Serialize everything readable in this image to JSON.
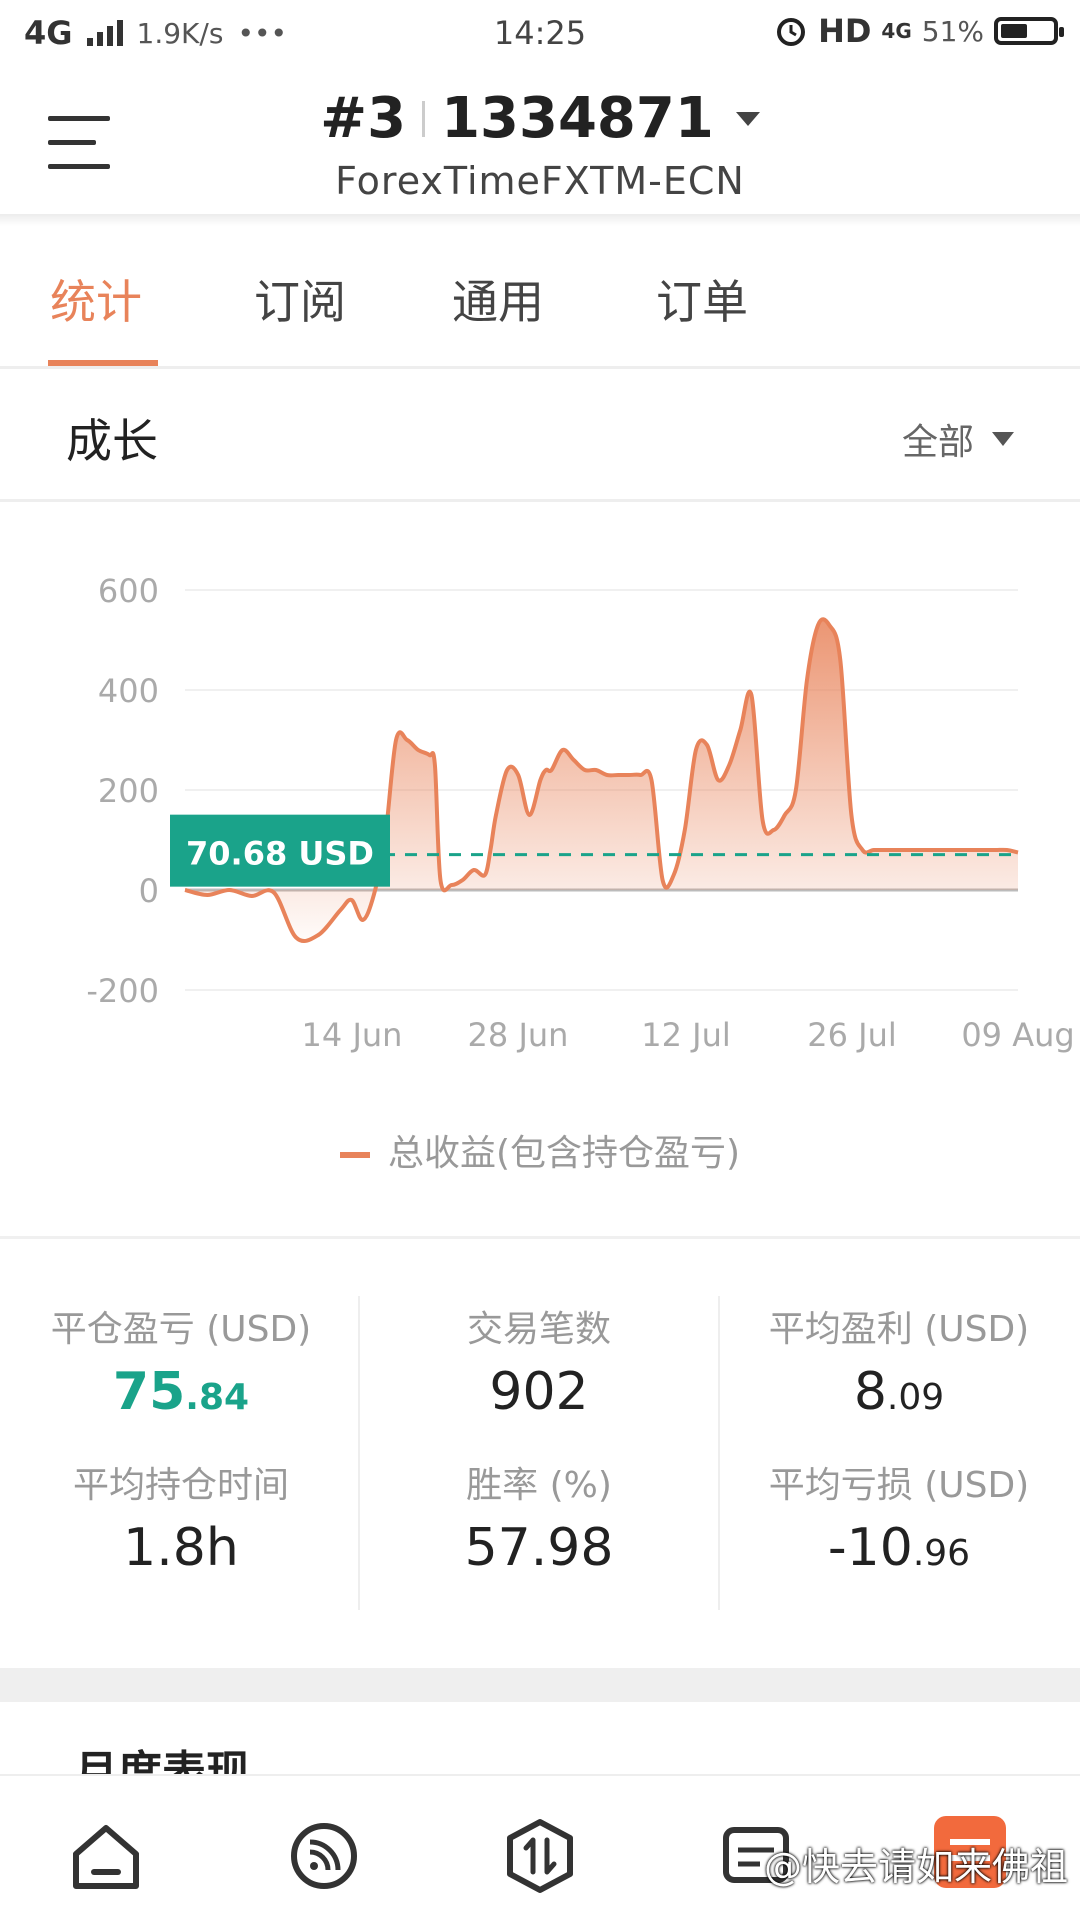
{
  "status_bar": {
    "network": "4G",
    "speed": "1.9K/s",
    "more": "•••",
    "time": "14:25",
    "hd": "HD",
    "net_right": "4G",
    "battery": "51%"
  },
  "header": {
    "account_index": "#3",
    "account_number": "1334871",
    "broker": "ForexTimeFXTM-ECN"
  },
  "tabs": [
    {
      "label": "统计",
      "active": true
    },
    {
      "label": "订阅",
      "active": false
    },
    {
      "label": "通用",
      "active": false
    },
    {
      "label": "订单",
      "active": false
    }
  ],
  "growth": {
    "title": "成长",
    "filter": "全部"
  },
  "chart_data": {
    "type": "area",
    "series": [
      {
        "name": "总收益(包含持仓盈亏)",
        "color": "#e8835a",
        "x": [
          0,
          2,
          4,
          6,
          8,
          10,
          12,
          14,
          15,
          16,
          17,
          18,
          19,
          20,
          21,
          22,
          22.5,
          23,
          24,
          25,
          26,
          27,
          27.5,
          28,
          29,
          30,
          31,
          32,
          32.5,
          33,
          34,
          35,
          36,
          37,
          38,
          39,
          40,
          41,
          42,
          43,
          44,
          45,
          46,
          47,
          48,
          49,
          50,
          51,
          52,
          53,
          54,
          55,
          56,
          57,
          58,
          59,
          60,
          61,
          62,
          63,
          64,
          65,
          66,
          67,
          68,
          69,
          70,
          71,
          72,
          73,
          74,
          75
        ],
        "y": [
          0,
          -10,
          0,
          -12,
          -5,
          -95,
          -90,
          -40,
          -20,
          -60,
          -10,
          100,
          300,
          300,
          280,
          270,
          250,
          20,
          10,
          20,
          40,
          30,
          80,
          150,
          240,
          230,
          150,
          220,
          240,
          240,
          280,
          260,
          240,
          240,
          230,
          230,
          230,
          230,
          220,
          20,
          30,
          120,
          280,
          290,
          220,
          250,
          320,
          390,
          140,
          120,
          150,
          200,
          420,
          530,
          530,
          460,
          150,
          80,
          80,
          80,
          80,
          80,
          80,
          80,
          80,
          80,
          80,
          80,
          80,
          80,
          80,
          75
        ]
      }
    ],
    "x_ticks": [
      "14 Jun",
      "28 Jun",
      "12 Jul",
      "26 Jul",
      "09 Aug"
    ],
    "y_ticks": [
      "600",
      "400",
      "200",
      "0",
      "-200"
    ],
    "ylim": [
      -200,
      600
    ],
    "current_value": 70.68,
    "current_label": "70.68 USD",
    "accent": "#1aa38a",
    "grid": true,
    "legend": "bottom-center"
  },
  "stats": [
    {
      "label": "平仓盈亏 (USD)",
      "int": "75",
      "dec": ".84",
      "green": true
    },
    {
      "label": "交易笔数",
      "int": "902",
      "dec": "",
      "green": false
    },
    {
      "label": "平均盈利 (USD)",
      "int": "8",
      "dec": ".09",
      "green": false
    },
    {
      "label": "平均持仓时间",
      "int": "1.8h",
      "dec": "",
      "green": false
    },
    {
      "label": "胜率 (%)",
      "int": "57.98",
      "dec": "",
      "green": false
    },
    {
      "label": "平均亏损 (USD)",
      "int": "-10",
      "dec": ".96",
      "green": false
    }
  ],
  "monthly": {
    "title": "月度表现"
  },
  "bottom_nav": {
    "watermark": "@快去请如来佛祖"
  },
  "icons": [
    "home-icon",
    "feed-icon",
    "trade-icon",
    "message-icon",
    "news-icon"
  ]
}
